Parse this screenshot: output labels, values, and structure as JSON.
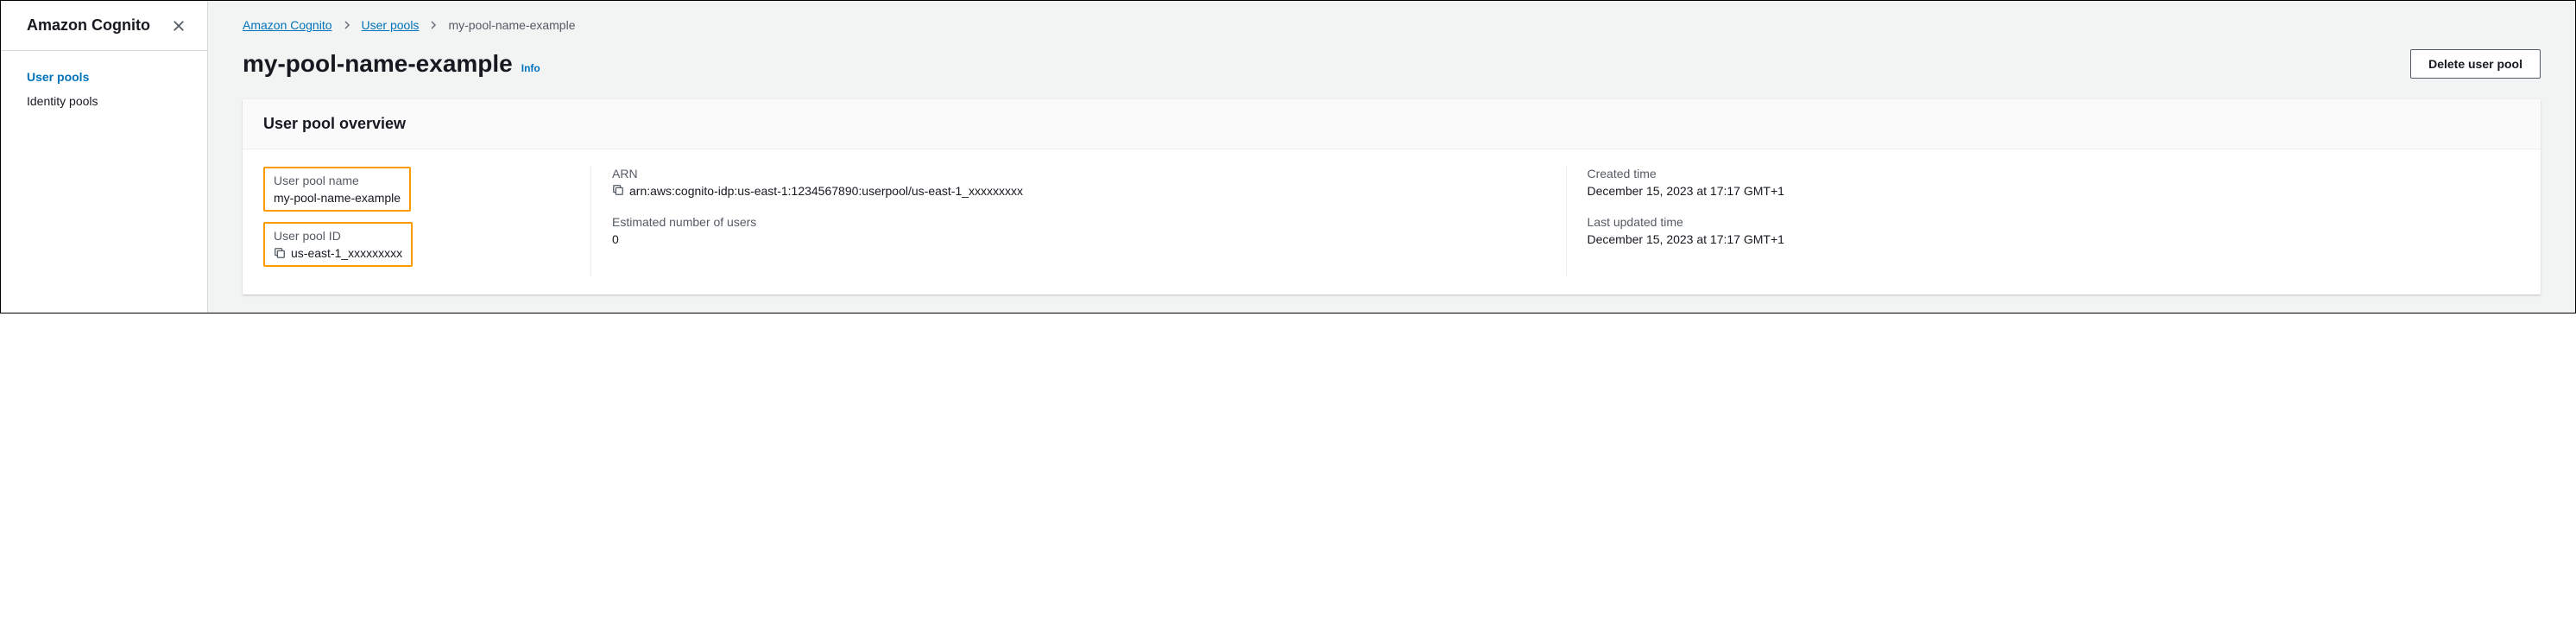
{
  "sidebar": {
    "title": "Amazon Cognito",
    "items": [
      {
        "label": "User pools",
        "active": true
      },
      {
        "label": "Identity pools",
        "active": false
      }
    ]
  },
  "breadcrumb": {
    "items": [
      {
        "label": "Amazon Cognito",
        "link": true
      },
      {
        "label": "User pools",
        "link": true
      },
      {
        "label": "my-pool-name-example",
        "link": false
      }
    ]
  },
  "header": {
    "title": "my-pool-name-example",
    "info_label": "Info",
    "delete_button": "Delete user pool"
  },
  "overview": {
    "panel_title": "User pool overview",
    "col1": {
      "pool_name_label": "User pool name",
      "pool_name_value": "my-pool-name-example",
      "pool_id_label": "User pool ID",
      "pool_id_value": "us-east-1_xxxxxxxxx"
    },
    "col2": {
      "arn_label": "ARN",
      "arn_value": "arn:aws:cognito-idp:us-east-1:1234567890:userpool/us-east-1_xxxxxxxxx",
      "users_label": "Estimated number of users",
      "users_value": "0"
    },
    "col3": {
      "created_label": "Created time",
      "created_value": "December 15, 2023 at 17:17 GMT+1",
      "updated_label": "Last updated time",
      "updated_value": "December 15, 2023 at 17:17 GMT+1"
    }
  }
}
